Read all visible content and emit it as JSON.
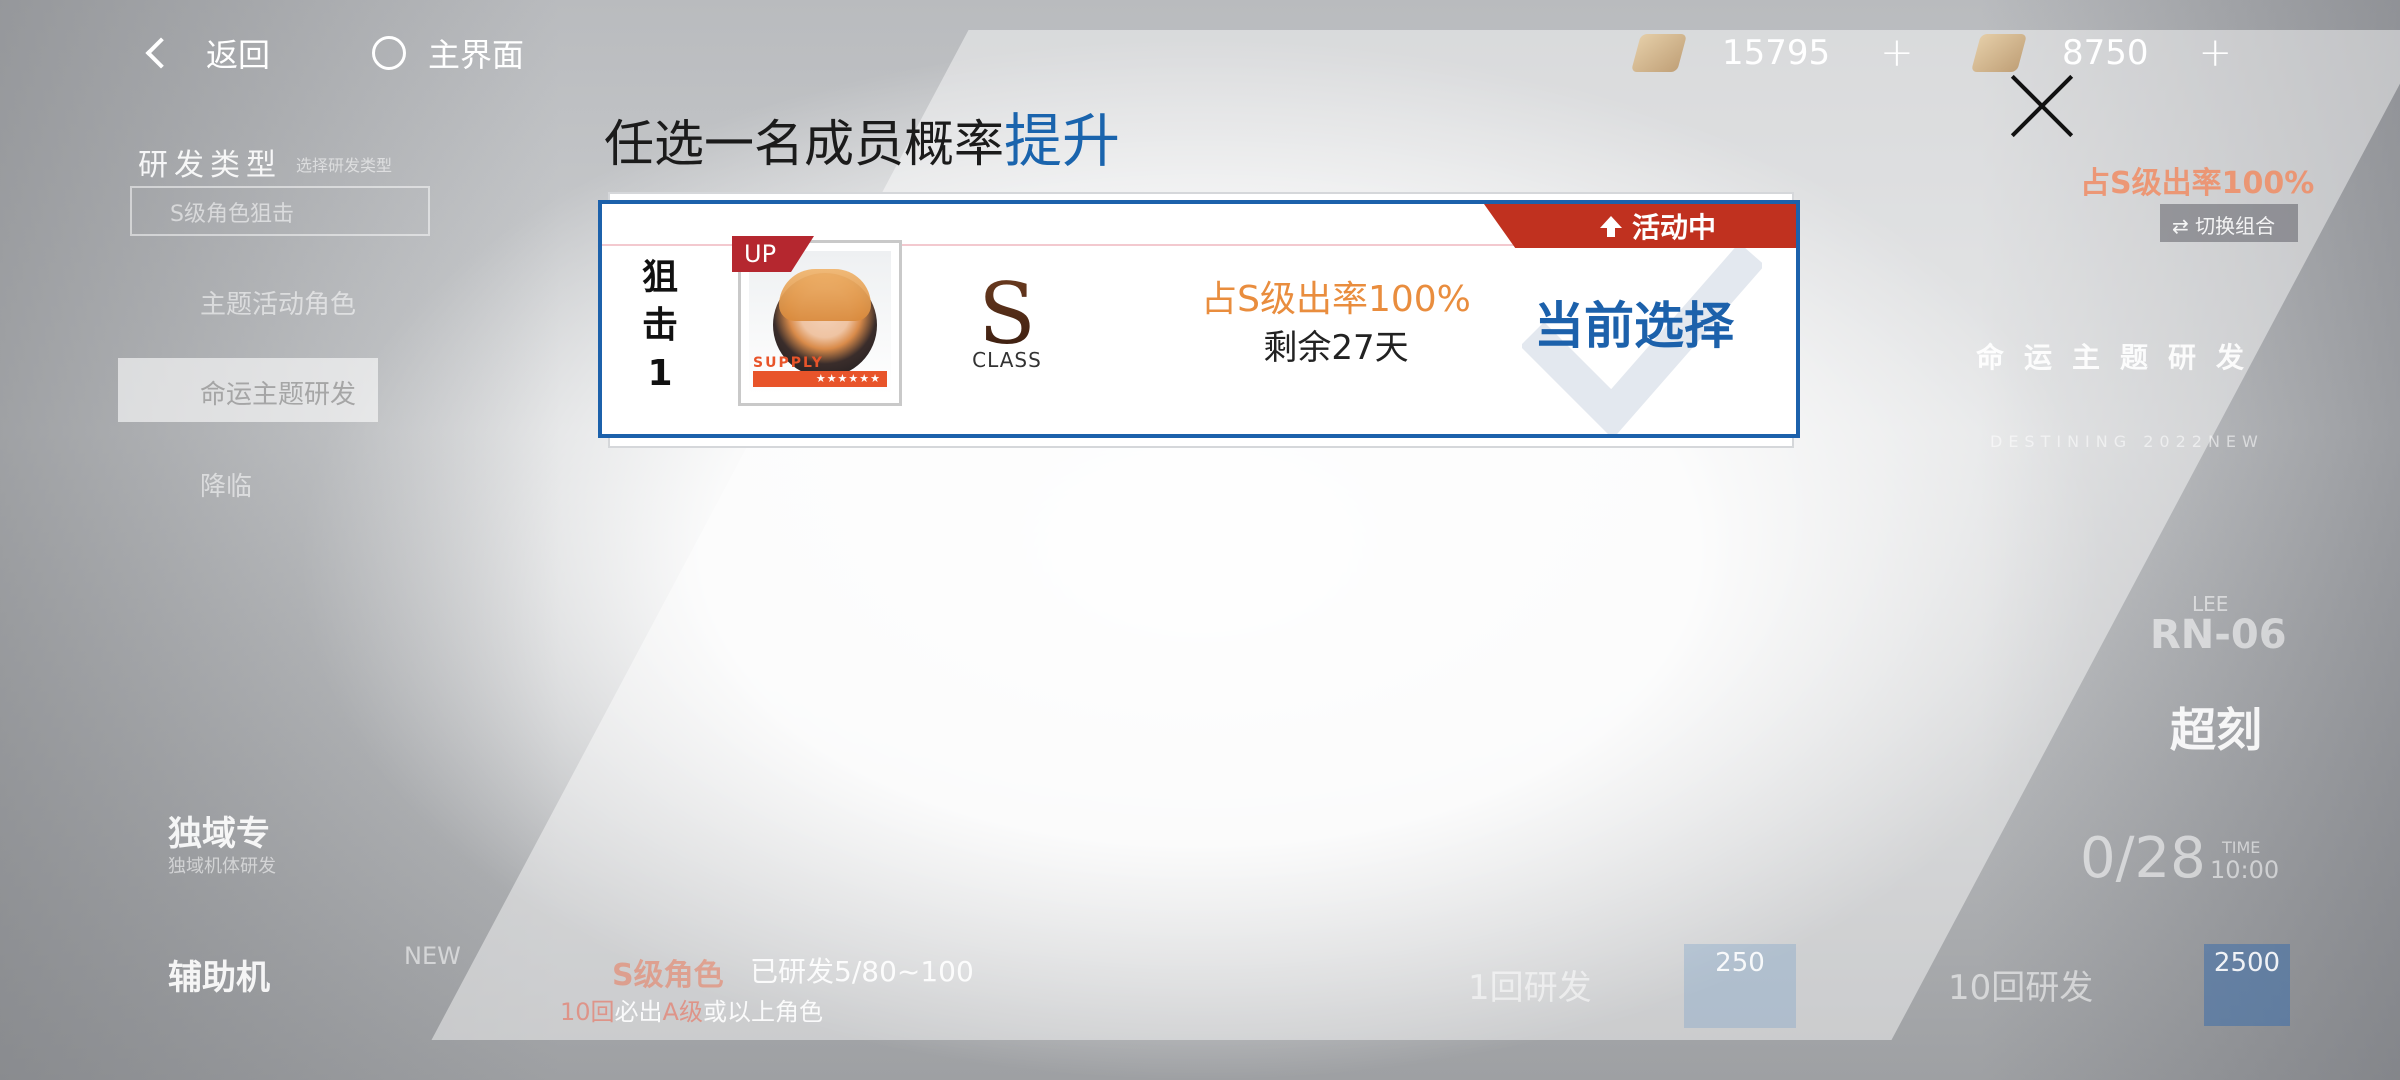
{
  "topbar": {
    "back_label": "返回",
    "home_label": "主界面",
    "currency1_value": "15795",
    "currency2_value": "8750",
    "plus_symbol": "+"
  },
  "background": {
    "research_type_label": "研发类型",
    "research_type_sub": "选择研发类型",
    "research_selected": "S级角色狙击",
    "menu_items": [
      "主题活动角色",
      "命运主题研发",
      "降临"
    ],
    "exclusive_label": "独域专",
    "exclusive_sub": "独域机体研发",
    "support_label": "辅助机",
    "new_badge": "NEW",
    "research_progress": "已研发5/80~100",
    "s_rank_char": "S级角色",
    "guarantee_prefix": "10回",
    "guarantee_mid": "必出",
    "guarantee_rank": "A级",
    "guarantee_suffix": "或以上角色",
    "pull_1_label": "1回研发",
    "pull_1_cost": "250",
    "pull_10_label": "10回研发",
    "pull_10_cost": "2500",
    "right_rate": "占S级出率100%",
    "switch_combo": "切换组合",
    "fate_theme": "命运主题研发",
    "fate_sub": "DESTINING 2022NEW",
    "code_label": "LEE",
    "code_value": "RN-06",
    "super_label": "超刻",
    "date_partial": "0/28",
    "time_label": "TIME",
    "time_value": "10:00"
  },
  "modal": {
    "title_prefix": "任选一名成员概率",
    "title_highlight": "提升",
    "card": {
      "role_chars": [
        "狙",
        "击"
      ],
      "role_number": "1",
      "up_tag": "UP",
      "supply_text": "SUPPLY",
      "stars": "★★★★★★",
      "class_letter": "S",
      "class_label": "CLASS",
      "rate_text": "占S级出率100%",
      "remaining_text": "剩余27天",
      "event_badge": "活动中",
      "current_select": "当前选择"
    }
  },
  "colors": {
    "accent_blue": "#1c61ab",
    "event_red": "#c0311f",
    "up_red": "#b5272f",
    "rate_orange": "#e98d3e"
  }
}
